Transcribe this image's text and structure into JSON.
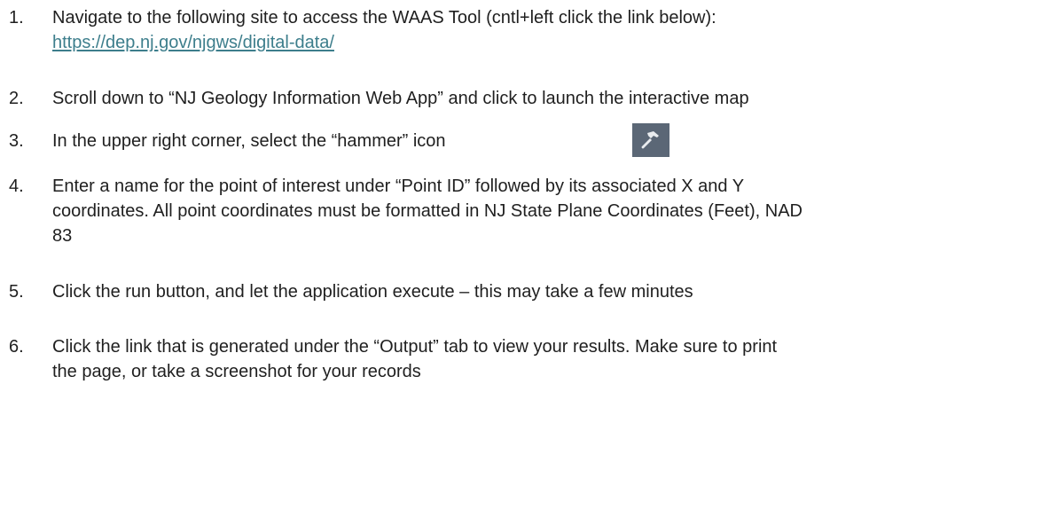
{
  "steps": [
    {
      "number": "1.",
      "text": "Navigate to the following site to access the WAAS Tool (cntl+left click the link below):",
      "link": "https://dep.nj.gov/njgws/digital-data/"
    },
    {
      "number": "2.",
      "text": "Scroll down to “NJ Geology Information Web App” and click to launch the interactive map"
    },
    {
      "number": "3.",
      "text": "In the upper right corner, select the “hammer” icon",
      "icon": "hammer-icon"
    },
    {
      "number": "4.",
      "line1": "Enter a name for the point of interest under “Point ID” followed by its associated X and Y",
      "line2": "coordinates. All point coordinates must be formatted in NJ State Plane Coordinates (Feet), NAD",
      "line3": "83"
    },
    {
      "number": "5.",
      "text": "Click the run button, and let the application execute – this may take a few minutes"
    },
    {
      "number": "6.",
      "line1": "Click the link that is generated under the “Output” tab to view your results. Make sure to print",
      "line2": "the page, or take a screenshot for your records"
    }
  ],
  "colors": {
    "text": "#1f1f1f",
    "link": "#3d7e8c",
    "icon_bg": "#5b6776",
    "icon_fg": "#e9ecef"
  }
}
